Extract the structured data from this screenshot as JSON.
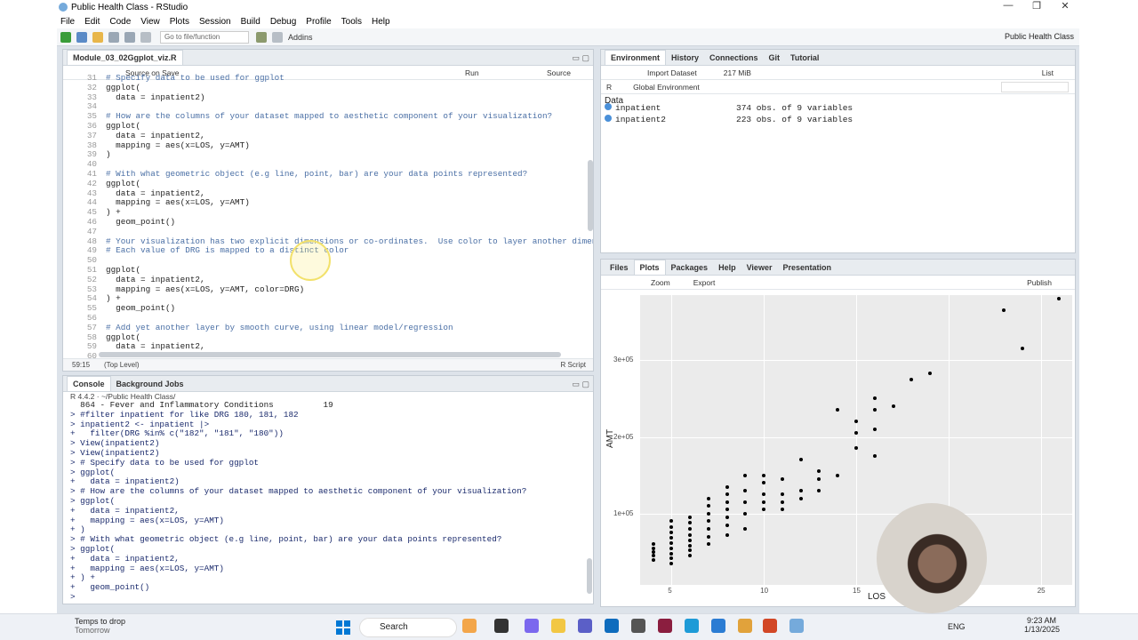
{
  "window": {
    "title": "Public Health Class - RStudio",
    "controls": [
      "—",
      "❐",
      "✕"
    ]
  },
  "menu": [
    "File",
    "Edit",
    "Code",
    "View",
    "Plots",
    "Session",
    "Build",
    "Debug",
    "Profile",
    "Tools",
    "Help"
  ],
  "toolbar": {
    "goto_placeholder": "Go to file/function",
    "addins": "Addins",
    "project": "Public Health Class"
  },
  "editor": {
    "tab": "Module_03_02Ggplot_viz.R",
    "source_on_save": "Source on Save",
    "run": "Run",
    "source": "Source",
    "status_pos": "59:15",
    "status_scope": "(Top Level)",
    "status_type": "R Script",
    "lines": [
      {
        "n": "31",
        "t": "# Specify data to be used for ggplot",
        "c": true
      },
      {
        "n": "32",
        "t": "ggplot("
      },
      {
        "n": "33",
        "t": "  data = inpatient2)"
      },
      {
        "n": "34",
        "t": ""
      },
      {
        "n": "35",
        "t": "# How are the columns of your dataset mapped to aesthetic component of your visualization?",
        "c": true
      },
      {
        "n": "36",
        "t": "ggplot("
      },
      {
        "n": "37",
        "t": "  data = inpatient2,"
      },
      {
        "n": "38",
        "t": "  mapping = aes(x=LOS, y=AMT)"
      },
      {
        "n": "39",
        "t": ")"
      },
      {
        "n": "40",
        "t": ""
      },
      {
        "n": "41",
        "t": "# With what geometric object (e.g line, point, bar) are your data points represented?",
        "c": true
      },
      {
        "n": "42",
        "t": "ggplot("
      },
      {
        "n": "43",
        "t": "  data = inpatient2,"
      },
      {
        "n": "44",
        "t": "  mapping = aes(x=LOS, y=AMT)"
      },
      {
        "n": "45",
        "t": ") +"
      },
      {
        "n": "46",
        "t": "  geom_point()"
      },
      {
        "n": "47",
        "t": ""
      },
      {
        "n": "48",
        "t": "# Your visualization has two explicit dimensions or co-ordinates.  Use color to layer another dimens",
        "c": true
      },
      {
        "n": "49",
        "t": "# Each value of DRG is mapped to a distinct color",
        "c": true
      },
      {
        "n": "50",
        "t": ""
      },
      {
        "n": "51",
        "t": "ggplot("
      },
      {
        "n": "52",
        "t": "  data = inpatient2,"
      },
      {
        "n": "53",
        "t": "  mapping = aes(x=LOS, y=AMT, color=DRG)"
      },
      {
        "n": "54",
        "t": ") +"
      },
      {
        "n": "55",
        "t": "  geom_point()"
      },
      {
        "n": "56",
        "t": ""
      },
      {
        "n": "57",
        "t": "# Add yet another layer by smooth curve, using linear model/regression",
        "c": true
      },
      {
        "n": "58",
        "t": "ggplot("
      },
      {
        "n": "59",
        "t": "  data = inpatient2,"
      },
      {
        "n": "60",
        "t": ""
      }
    ]
  },
  "console": {
    "tabs": [
      "Console",
      "Background Jobs"
    ],
    "path": "R 4.4.2 · ~/Public Health Class/",
    "lines": [
      {
        "t": "  864 - Fever and Inflammatory Conditions          19",
        "o": true
      },
      {
        "t": "> #filter inpatient for like DRG 180, 181, 182"
      },
      {
        "t": "> inpatient2 <- inpatient |>"
      },
      {
        "t": "+   filter(DRG %in% c(\"182\", \"181\", \"180\"))"
      },
      {
        "t": "> View(inpatient2)"
      },
      {
        "t": "> View(inpatient2)"
      },
      {
        "t": "> # Specify data to be used for ggplot"
      },
      {
        "t": "> ggplot("
      },
      {
        "t": "+   data = inpatient2)"
      },
      {
        "t": "> # How are the columns of your dataset mapped to aesthetic component of your visualization?"
      },
      {
        "t": "> ggplot("
      },
      {
        "t": "+   data = inpatient2,"
      },
      {
        "t": "+   mapping = aes(x=LOS, y=AMT)"
      },
      {
        "t": "+ )"
      },
      {
        "t": "> # With what geometric object (e.g line, point, bar) are your data points represented?"
      },
      {
        "t": "> ggplot("
      },
      {
        "t": "+   data = inpatient2,"
      },
      {
        "t": "+   mapping = aes(x=LOS, y=AMT)"
      },
      {
        "t": "+ ) +"
      },
      {
        "t": "+   geom_point()"
      },
      {
        "t": ">"
      }
    ]
  },
  "environment": {
    "tabs": [
      "Environment",
      "History",
      "Connections",
      "Git",
      "Tutorial"
    ],
    "import": "Import Dataset",
    "mem": "217 MiB",
    "list": "List",
    "lang": "R",
    "scope": "Global Environment",
    "section": "Data",
    "rows": [
      {
        "name": "inpatient",
        "desc": "374 obs. of 9 variables"
      },
      {
        "name": "inpatient2",
        "desc": "223 obs. of 9 variables"
      }
    ]
  },
  "files": {
    "tabs": [
      "Files",
      "Plots",
      "Packages",
      "Help",
      "Viewer",
      "Presentation"
    ],
    "zoom": "Zoom",
    "export": "Export",
    "publish": "Publish"
  },
  "chart_data": {
    "type": "scatter",
    "xlabel": "LOS",
    "ylabel": "AMT",
    "xticks": [
      "5",
      "10",
      "15",
      "20",
      "25"
    ],
    "yticks": [
      "1e+05",
      "2e+05",
      "3e+05"
    ],
    "xlim": [
      3.3,
      26.7
    ],
    "ylim": [
      7000,
      385000
    ],
    "points": [
      [
        4,
        40000
      ],
      [
        4,
        45000
      ],
      [
        4,
        50000
      ],
      [
        4,
        55000
      ],
      [
        4,
        60000
      ],
      [
        5,
        35000
      ],
      [
        5,
        42000
      ],
      [
        5,
        48000
      ],
      [
        5,
        55000
      ],
      [
        5,
        62000
      ],
      [
        5,
        68000
      ],
      [
        5,
        75000
      ],
      [
        5,
        82000
      ],
      [
        5,
        90000
      ],
      [
        6,
        45000
      ],
      [
        6,
        52000
      ],
      [
        6,
        58000
      ],
      [
        6,
        65000
      ],
      [
        6,
        72000
      ],
      [
        6,
        80000
      ],
      [
        6,
        88000
      ],
      [
        6,
        95000
      ],
      [
        7,
        60000
      ],
      [
        7,
        70000
      ],
      [
        7,
        80000
      ],
      [
        7,
        90000
      ],
      [
        7,
        100000
      ],
      [
        7,
        110000
      ],
      [
        7,
        120000
      ],
      [
        8,
        72000
      ],
      [
        8,
        85000
      ],
      [
        8,
        95000
      ],
      [
        8,
        105000
      ],
      [
        8,
        115000
      ],
      [
        8,
        125000
      ],
      [
        8,
        135000
      ],
      [
        9,
        80000
      ],
      [
        9,
        100000
      ],
      [
        9,
        115000
      ],
      [
        9,
        130000
      ],
      [
        9,
        150000
      ],
      [
        10,
        105000
      ],
      [
        10,
        115000
      ],
      [
        10,
        125000
      ],
      [
        10,
        140000
      ],
      [
        10,
        150000
      ],
      [
        11,
        105000
      ],
      [
        11,
        115000
      ],
      [
        11,
        125000
      ],
      [
        11,
        145000
      ],
      [
        12,
        120000
      ],
      [
        12,
        130000
      ],
      [
        12,
        170000
      ],
      [
        13,
        130000
      ],
      [
        13,
        145000
      ],
      [
        13,
        155000
      ],
      [
        14,
        150000
      ],
      [
        14,
        235000
      ],
      [
        15,
        185000
      ],
      [
        15,
        205000
      ],
      [
        15,
        220000
      ],
      [
        16,
        175000
      ],
      [
        16,
        210000
      ],
      [
        16,
        235000
      ],
      [
        16,
        250000
      ],
      [
        17,
        240000
      ],
      [
        18,
        275000
      ],
      [
        19,
        283000
      ],
      [
        23,
        365000
      ],
      [
        24,
        315000
      ],
      [
        26,
        380000
      ]
    ]
  },
  "taskbar": {
    "weather": "Temps to drop",
    "weather_sub": "Tomorrow",
    "search": "Search",
    "lang": "ENG",
    "time": "9:23 AM",
    "date": "1/13/2025"
  }
}
